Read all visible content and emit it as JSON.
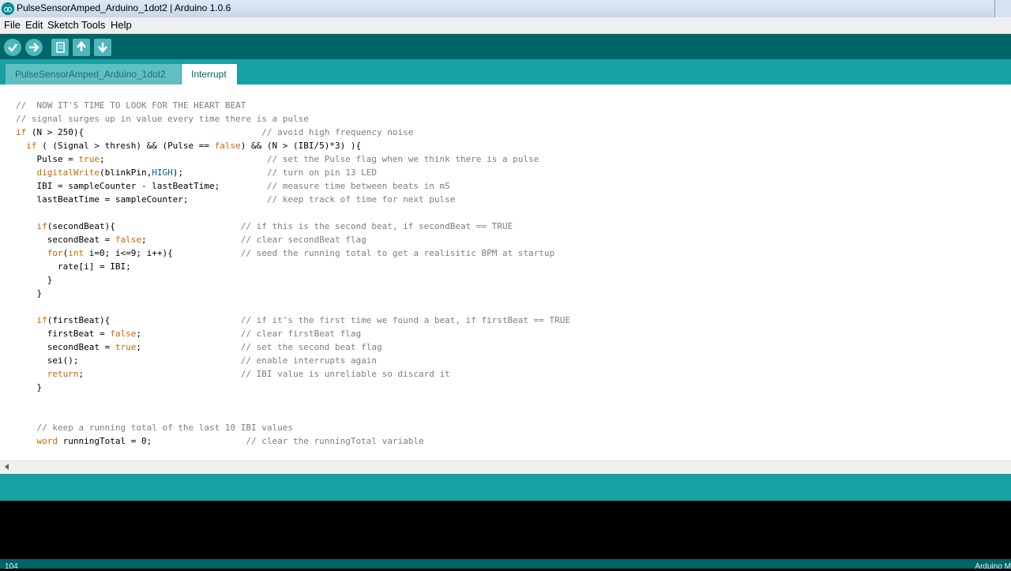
{
  "window": {
    "title": "PulseSensorAmped_Arduino_1dot2 | Arduino 1.0.6"
  },
  "menu": {
    "items": [
      "File",
      "Edit",
      "Sketch",
      "Tools",
      "Help"
    ]
  },
  "toolbar": {
    "buttons": [
      "verify-icon",
      "upload-icon",
      "new-icon",
      "open-icon",
      "save-icon"
    ]
  },
  "tabs": [
    {
      "label": "PulseSensorAmped_Arduino_1dot2",
      "active": false
    },
    {
      "label": "Interrupt",
      "active": true
    }
  ],
  "editor": {
    "lines": [
      [
        {
          "t": "cm",
          "v": "//  NOW IT'S TIME TO LOOK FOR THE HEART BEAT"
        }
      ],
      [
        {
          "t": "cm",
          "v": "// signal surges up in value every time there is a pulse"
        }
      ],
      [
        {
          "t": "kw",
          "v": "if"
        },
        {
          "t": "",
          "v": " (N > 250){                                  "
        },
        {
          "t": "cm",
          "v": "// avoid high frequency noise"
        }
      ],
      [
        {
          "t": "",
          "v": "  "
        },
        {
          "t": "kw",
          "v": "if"
        },
        {
          "t": "",
          "v": " ( (Signal > thresh) && (Pulse == "
        },
        {
          "t": "kw",
          "v": "false"
        },
        {
          "t": "",
          "v": ") && (N > (IBI/5)*3) ){"
        }
      ],
      [
        {
          "t": "",
          "v": "    Pulse = "
        },
        {
          "t": "kw",
          "v": "true"
        },
        {
          "t": "",
          "v": ";                               "
        },
        {
          "t": "cm",
          "v": "// set the Pulse flag when we think there is a pulse"
        }
      ],
      [
        {
          "t": "",
          "v": "    "
        },
        {
          "t": "fn",
          "v": "digitalWrite"
        },
        {
          "t": "",
          "v": "(blinkPin,"
        },
        {
          "t": "const",
          "v": "HIGH"
        },
        {
          "t": "",
          "v": ");                "
        },
        {
          "t": "cm",
          "v": "// turn on pin 13 LED"
        }
      ],
      [
        {
          "t": "",
          "v": "    IBI = sampleCounter - lastBeatTime;         "
        },
        {
          "t": "cm",
          "v": "// measure time between beats in mS"
        }
      ],
      [
        {
          "t": "",
          "v": "    lastBeatTime = sampleCounter;               "
        },
        {
          "t": "cm",
          "v": "// keep track of time for next pulse"
        }
      ],
      [
        {
          "t": "",
          "v": ""
        }
      ],
      [
        {
          "t": "",
          "v": "    "
        },
        {
          "t": "kw",
          "v": "if"
        },
        {
          "t": "",
          "v": "(secondBeat){                        "
        },
        {
          "t": "cm",
          "v": "// if this is the second beat, if secondBeat == TRUE"
        }
      ],
      [
        {
          "t": "",
          "v": "      secondBeat = "
        },
        {
          "t": "kw",
          "v": "false"
        },
        {
          "t": "",
          "v": ";                  "
        },
        {
          "t": "cm",
          "v": "// clear secondBeat flag"
        }
      ],
      [
        {
          "t": "",
          "v": "      "
        },
        {
          "t": "kw",
          "v": "for"
        },
        {
          "t": "",
          "v": "("
        },
        {
          "t": "kw",
          "v": "int"
        },
        {
          "t": "",
          "v": " i=0; i<=9; i++){             "
        },
        {
          "t": "cm",
          "v": "// seed the running total to get a realisitic BPM at startup"
        }
      ],
      [
        {
          "t": "",
          "v": "        rate[i] = IBI;"
        }
      ],
      [
        {
          "t": "",
          "v": "      }"
        }
      ],
      [
        {
          "t": "",
          "v": "    }"
        }
      ],
      [
        {
          "t": "",
          "v": ""
        }
      ],
      [
        {
          "t": "",
          "v": "    "
        },
        {
          "t": "kw",
          "v": "if"
        },
        {
          "t": "",
          "v": "(firstBeat){                         "
        },
        {
          "t": "cm",
          "v": "// if it's the first time we found a beat, if firstBeat == TRUE"
        }
      ],
      [
        {
          "t": "",
          "v": "      firstBeat = "
        },
        {
          "t": "kw",
          "v": "false"
        },
        {
          "t": "",
          "v": ";                   "
        },
        {
          "t": "cm",
          "v": "// clear firstBeat flag"
        }
      ],
      [
        {
          "t": "",
          "v": "      secondBeat = "
        },
        {
          "t": "kw",
          "v": "true"
        },
        {
          "t": "",
          "v": ";                   "
        },
        {
          "t": "cm",
          "v": "// set the second beat flag"
        }
      ],
      [
        {
          "t": "",
          "v": "      sei();                               "
        },
        {
          "t": "cm",
          "v": "// enable interrupts again"
        }
      ],
      [
        {
          "t": "",
          "v": "      "
        },
        {
          "t": "kw",
          "v": "return"
        },
        {
          "t": "",
          "v": ";                              "
        },
        {
          "t": "cm",
          "v": "// IBI value is unreliable so discard it"
        }
      ],
      [
        {
          "t": "",
          "v": "    }"
        }
      ],
      [
        {
          "t": "",
          "v": ""
        }
      ],
      [
        {
          "t": "",
          "v": ""
        }
      ],
      [
        {
          "t": "",
          "v": "    "
        },
        {
          "t": "cm",
          "v": "// keep a running total of the last 10 IBI values"
        }
      ],
      [
        {
          "t": "",
          "v": "    "
        },
        {
          "t": "kw",
          "v": "word"
        },
        {
          "t": "",
          "v": " runningTotal = 0;                  "
        },
        {
          "t": "cm",
          "v": "// clear the runningTotal variable"
        }
      ]
    ]
  },
  "footer": {
    "line_number": "104",
    "board": "Arduino M"
  },
  "colors": {
    "toolbar": "#006468",
    "tabbar": "#17a1a5",
    "keyword": "#cc6600",
    "constant": "#006699",
    "comment": "#7e7e7e"
  }
}
